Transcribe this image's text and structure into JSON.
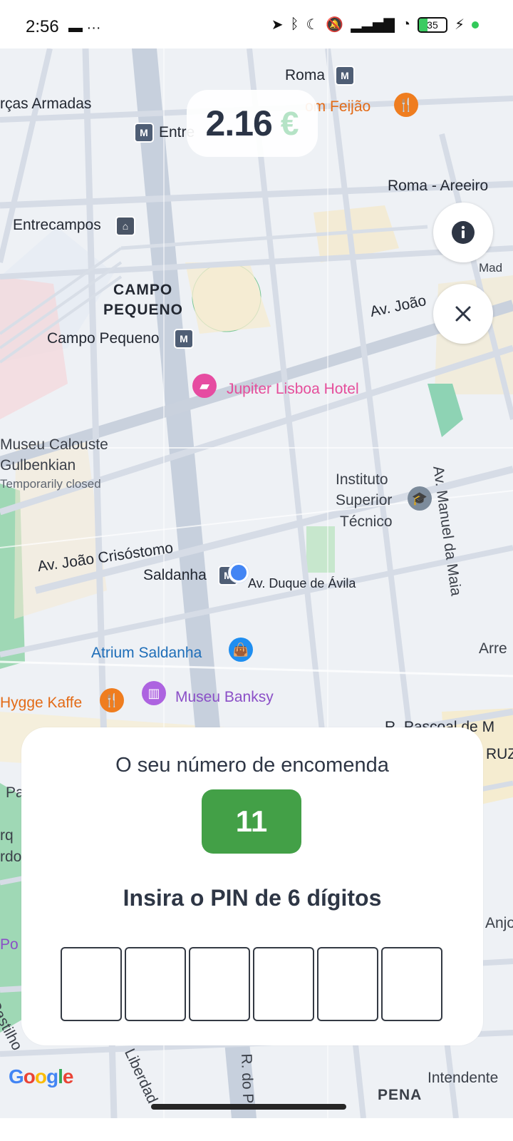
{
  "status_bar": {
    "time": "2:56",
    "battery": "35"
  },
  "map": {
    "labels": {
      "forcas_armadas": "rças Armadas",
      "roma": "Roma",
      "bom_feijao": "om Feijão",
      "entrecampos_metro": "Entre",
      "roma_areeiro": "Roma - Areeiro",
      "entrecampos_bus": "Entrecampos",
      "campo_pequeno_line1": "CAMPO",
      "campo_pequeno_line2": "PEQUENO",
      "campo_pequeno_metro": "Campo Pequeno",
      "av_joao": "Av. João",
      "jupiter_hotel": "Jupiter Lisboa Hotel",
      "museu_line1": "Museu Calouste",
      "museu_line2": "Gulbenkian",
      "museu_status": "Temporarily closed",
      "ist_line1": "Instituto",
      "ist_line2": "Superior",
      "ist_line3": "Técnico",
      "av_manuel": "Av. Manuel da Maia",
      "av_joao_crisostomo": "Av. João Crisóstomo",
      "saldanha": "Saldanha",
      "av_duque": "Av. Duque de Ávila",
      "atrium": "Atrium Saldanha",
      "hygge": "Hygge Kaffe",
      "museu_banksy": "Museu Banksy",
      "r_pascoal": "R. Pascoal de M",
      "intendente": "Intendente",
      "pena": "PENA",
      "liberdade": "Liberdad",
      "r_do_p": "R. do P",
      "castilho": "Castilho",
      "mad": "Mad",
      "arre": "Arre",
      "anjo": "Anjo",
      "ruz": "RUZ",
      "pa": "Pa",
      "rq": "rq",
      "rdo": "rdo",
      "po": "Po"
    },
    "brand": "Google"
  },
  "price": {
    "value": "2.16",
    "currency": "€"
  },
  "buttons": {
    "info_icon": "info-icon",
    "close_icon": "close-icon"
  },
  "order_sheet": {
    "title": "O seu número de encomenda",
    "order_number": "11",
    "pin_title": "Insira o PIN de 6 dígitos",
    "pin_boxes": [
      "",
      "",
      "",
      "",
      "",
      ""
    ]
  },
  "colors": {
    "accent_green": "#43a047",
    "text_dark": "#2e3645"
  }
}
